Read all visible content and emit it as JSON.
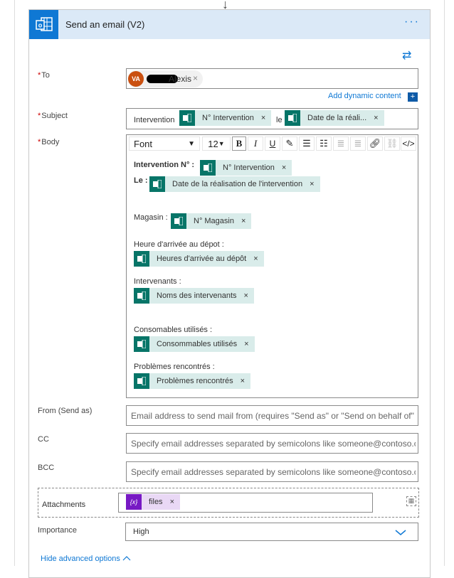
{
  "header": {
    "title": "Send an email (V2)",
    "more": "···"
  },
  "to": {
    "label": "To",
    "avatar": "VA",
    "name": "Alexis"
  },
  "add_dynamic": "Add dynamic content",
  "subject": {
    "label": "Subject",
    "text1": "Intervention",
    "token1": "N° Intervention",
    "text2": "le",
    "token2": "Date de la réali..."
  },
  "body": {
    "label": "Body",
    "font": "Font",
    "size": "12",
    "lines": [
      {
        "label": "Intervention N° :",
        "token": "N° Intervention"
      },
      {
        "label": "Le :",
        "token": "Date de la réalisation de l'intervention"
      },
      {
        "label": "Magasin :",
        "token": "N° Magasin"
      },
      {
        "label": "Heure d'arrivée au dépot :",
        "token": "Heures d'arrivée au dépôt"
      },
      {
        "label": "Intervenants :",
        "token": "Noms des intervenants"
      },
      {
        "label": "Consomables utilisés :",
        "token": "Consommables utilisés"
      },
      {
        "label": "Problèmes rencontrés :",
        "token": "Problèmes rencontrés"
      }
    ]
  },
  "from": {
    "label": "From (Send as)",
    "placeholder": "Email address to send mail from (requires \"Send as\" or \"Send on behalf of\" permission)"
  },
  "cc": {
    "label": "CC",
    "placeholder": "Specify email addresses separated by semicolons like someone@contoso.com"
  },
  "bcc": {
    "label": "BCC",
    "placeholder": "Specify email addresses separated by semicolons like someone@contoso.com"
  },
  "attachments": {
    "label": "Attachments",
    "token": "files",
    "token_icon": "{x}"
  },
  "importance": {
    "label": "Importance",
    "value": "High"
  },
  "hide_advanced": "Hide advanced options",
  "colors": {
    "accent": "#0f78d4",
    "token_bg": "#d9ecea",
    "token_icon": "#077568",
    "var_bg": "#e9d8f5",
    "var_icon": "#7719c4"
  }
}
